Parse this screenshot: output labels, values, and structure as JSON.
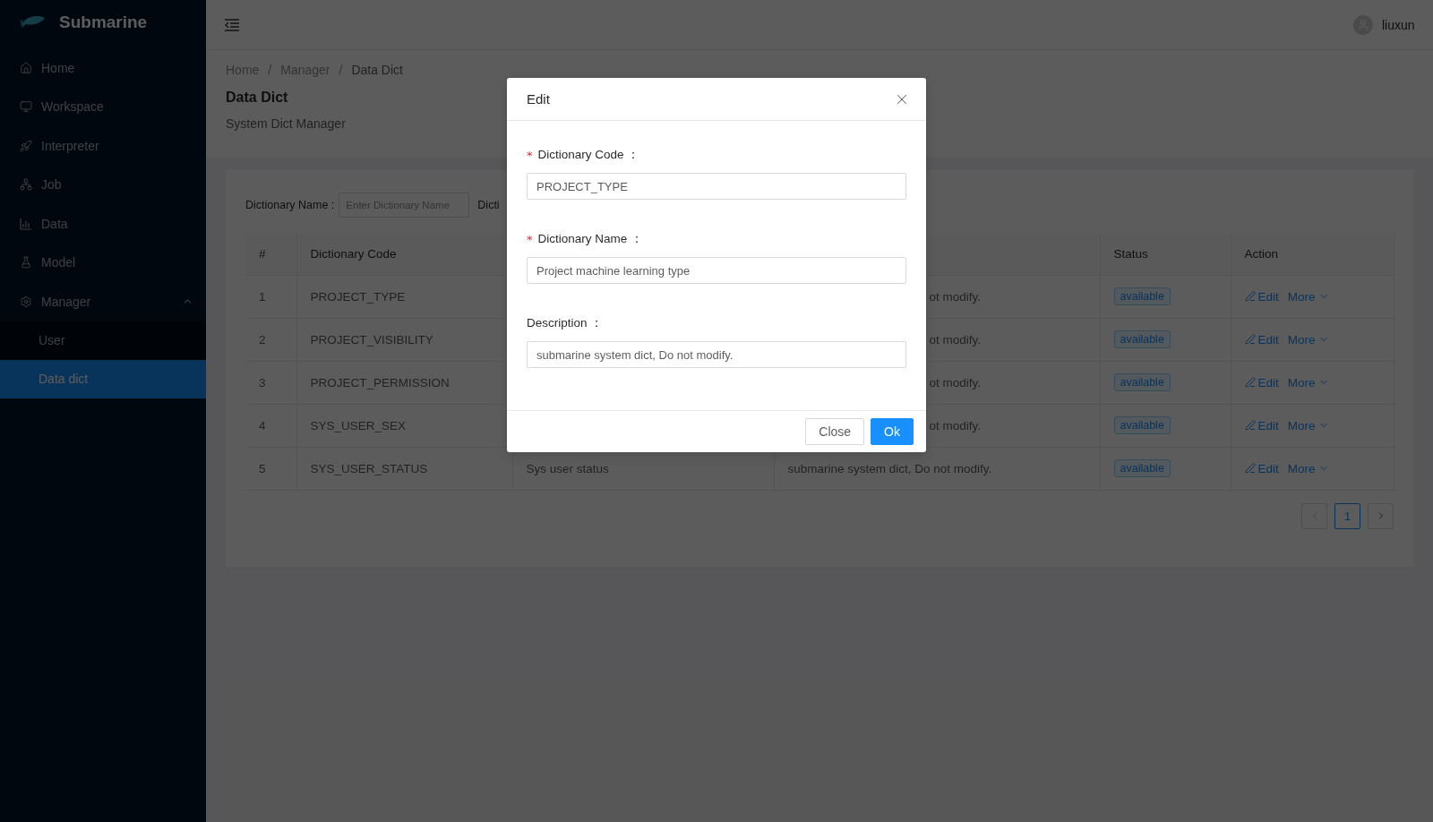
{
  "app": {
    "name": "Submarine"
  },
  "sidebar": {
    "items": [
      {
        "label": "Home",
        "selected": false
      },
      {
        "label": "Workspace",
        "selected": false
      },
      {
        "label": "Interpreter",
        "selected": false
      },
      {
        "label": "Job",
        "selected": false
      },
      {
        "label": "Data",
        "selected": false
      },
      {
        "label": "Model",
        "selected": false
      },
      {
        "label": "Manager",
        "selected": false,
        "expanded": true,
        "children": [
          {
            "label": "User",
            "selected": false
          },
          {
            "label": "Data dict",
            "selected": true
          }
        ]
      }
    ]
  },
  "header": {
    "user": "liuxun"
  },
  "breadcrumb": {
    "separator": "/",
    "items": [
      "Home",
      "Manager",
      "Data Dict"
    ]
  },
  "page": {
    "title": "Data Dict",
    "subtitle": "System Dict Manager"
  },
  "filter": {
    "label": "Dictionary Name :",
    "placeholder": "Enter Dictionary Name",
    "next_label": "Dicti"
  },
  "table": {
    "columns": [
      "#",
      "Dictionary Code",
      "Status",
      "Action"
    ],
    "rows": [
      {
        "kind": "covered",
        "index": "1",
        "code": "PROJECT_TYPE",
        "description": "ot modify.",
        "status": "available",
        "edit": "Edit",
        "more": "More"
      },
      {
        "kind": "covered",
        "index": "2",
        "code": "PROJECT_VISIBILITY",
        "description": "ot modify.",
        "status": "available",
        "edit": "Edit",
        "more": "More"
      },
      {
        "kind": "covered",
        "index": "3",
        "code": "PROJECT_PERMISSION",
        "description": "ot modify.",
        "status": "available",
        "edit": "Edit",
        "more": "More"
      },
      {
        "kind": "covered",
        "index": "4",
        "code": "SYS_USER_SEX",
        "description": "ot modify.",
        "status": "available",
        "edit": "Edit",
        "more": "More"
      },
      {
        "kind": "full",
        "index": "5",
        "code": "SYS_USER_STATUS",
        "name": "Sys user status",
        "description": "submarine system dict, Do not modify.",
        "status": "available",
        "edit": "Edit",
        "more": "More"
      }
    ]
  },
  "pagination": {
    "pages": [
      {
        "label": "1",
        "selected": true
      }
    ],
    "prev_disabled": true
  },
  "modal": {
    "title": "Edit",
    "fields": [
      {
        "label": "Dictionary Code",
        "required": true,
        "value": "PROJECT_TYPE"
      },
      {
        "label": "Dictionary Name",
        "required": true,
        "value": "Project machine learning type"
      },
      {
        "label": "Description",
        "required": false,
        "value": "submarine system dict, Do not modify."
      }
    ],
    "colon": "：",
    "required_mark": "*",
    "buttons": [
      {
        "label": "Close",
        "kind": "default"
      },
      {
        "label": "Ok",
        "kind": "primary"
      }
    ]
  }
}
